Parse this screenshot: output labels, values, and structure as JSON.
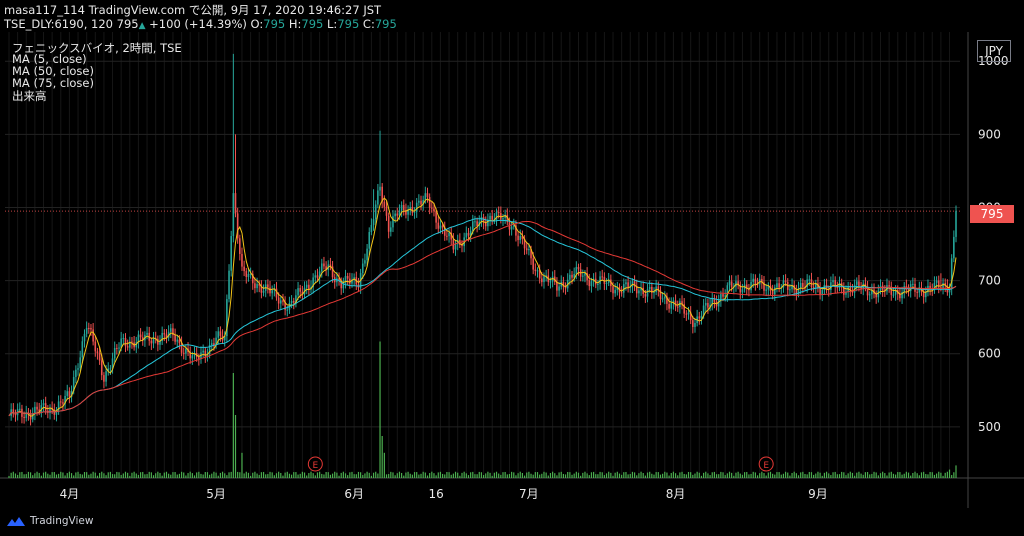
{
  "header": {
    "line1": "masa117_114 TradingView.com で公開, 9月 17, 2020 19:46:27 JST",
    "symbol": "TSE_DLY:6190, 120",
    "last": "795",
    "arrow": "▲",
    "change": "+100 (+14.39%)",
    "o_label": "O:",
    "o": "795",
    "h_label": "H:",
    "h": "795",
    "l_label": "L:",
    "l": "795",
    "c_label": "C:",
    "c": "795"
  },
  "legend": {
    "title": "フェニックスバイオ, 2時間, TSE",
    "ma5": "MA (5, close)",
    "ma50": "MA (50, close)",
    "ma75": "MA (75, close)",
    "volume": "出来高"
  },
  "currency": "JPY",
  "last_price_label": "795",
  "footer": {
    "brand": "TradingView"
  },
  "colors": {
    "up": "#26a69a",
    "down": "#ef5350",
    "ma5": "#f5c518",
    "ma50": "#26c6da",
    "ma75": "#e53935",
    "volume": "#4caf50",
    "earnings": "#e53935"
  },
  "chart_data": {
    "type": "candlestick",
    "y_ticks": [
      500,
      600,
      700,
      800,
      900,
      1000
    ],
    "ylim": [
      430,
      1040
    ],
    "x_labels": [
      "4月",
      "5月",
      "6月",
      "16",
      "7月",
      "8月",
      "9月"
    ],
    "x_label_index": [
      28,
      96,
      160,
      198,
      241,
      309,
      375
    ],
    "n_bars": 440,
    "earnings_marker_label": "E",
    "earnings_index": [
      142,
      351
    ],
    "close_keypoints": [
      [
        0,
        515
      ],
      [
        10,
        520
      ],
      [
        20,
        525
      ],
      [
        28,
        540
      ],
      [
        36,
        640
      ],
      [
        44,
        570
      ],
      [
        52,
        615
      ],
      [
        64,
        620
      ],
      [
        76,
        625
      ],
      [
        86,
        590
      ],
      [
        96,
        620
      ],
      [
        100,
        620
      ],
      [
        104,
        820
      ],
      [
        108,
        710
      ],
      [
        118,
        690
      ],
      [
        130,
        665
      ],
      [
        140,
        700
      ],
      [
        148,
        720
      ],
      [
        154,
        695
      ],
      [
        162,
        700
      ],
      [
        168,
        770
      ],
      [
        172,
        830
      ],
      [
        176,
        775
      ],
      [
        180,
        790
      ],
      [
        186,
        800
      ],
      [
        194,
        810
      ],
      [
        200,
        775
      ],
      [
        206,
        745
      ],
      [
        214,
        770
      ],
      [
        224,
        790
      ],
      [
        234,
        775
      ],
      [
        244,
        715
      ],
      [
        254,
        690
      ],
      [
        262,
        710
      ],
      [
        272,
        700
      ],
      [
        282,
        690
      ],
      [
        292,
        690
      ],
      [
        302,
        680
      ],
      [
        312,
        660
      ],
      [
        318,
        645
      ],
      [
        326,
        670
      ],
      [
        334,
        690
      ],
      [
        344,
        695
      ],
      [
        356,
        690
      ],
      [
        370,
        693
      ],
      [
        380,
        691
      ],
      [
        392,
        690
      ],
      [
        404,
        685
      ],
      [
        420,
        687
      ],
      [
        430,
        690
      ],
      [
        436,
        695
      ],
      [
        439,
        795
      ]
    ],
    "spikes": [
      [
        104,
        1010
      ],
      [
        105,
        900
      ],
      [
        172,
        905
      ],
      [
        169,
        825
      ],
      [
        344,
        710
      ],
      [
        432,
        710
      ]
    ],
    "volume_spikes": [
      [
        104,
        0.5
      ],
      [
        105,
        0.3
      ],
      [
        172,
        0.65
      ],
      [
        173,
        0.2
      ],
      [
        108,
        0.12
      ],
      [
        174,
        0.12
      ],
      [
        439,
        0.06
      ],
      [
        436,
        0.04
      ]
    ]
  }
}
